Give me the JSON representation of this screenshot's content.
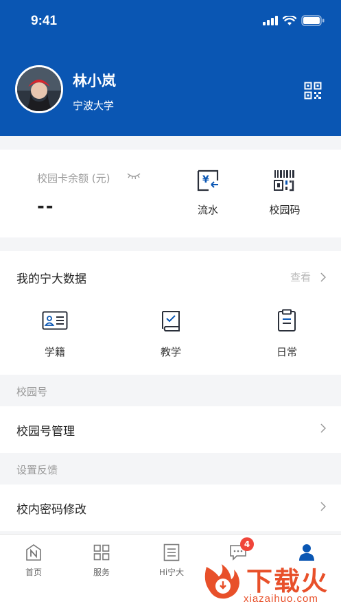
{
  "status_bar": {
    "time": "9:41"
  },
  "profile": {
    "name": "林小岚",
    "school": "宁波大学"
  },
  "campus_card": {
    "balance_label": "校园卡余额 (元)",
    "balance_value": "--",
    "actions": [
      {
        "label": "流水",
        "icon": "transaction-flow-icon"
      },
      {
        "label": "校园码",
        "icon": "campus-barcode-icon"
      }
    ]
  },
  "my_data": {
    "title": "我的宁大数据",
    "view_label": "查看",
    "items": [
      {
        "label": "学籍",
        "icon": "student-id-icon"
      },
      {
        "label": "教学",
        "icon": "teaching-icon"
      },
      {
        "label": "日常",
        "icon": "daily-clipboard-icon"
      }
    ]
  },
  "groups": [
    {
      "label": "校园号",
      "rows": [
        {
          "label": "校园号管理"
        }
      ]
    },
    {
      "label": "设置反馈",
      "rows": [
        {
          "label": "校内密码修改"
        }
      ]
    }
  ],
  "tabbar": {
    "tabs": [
      {
        "label": "首页",
        "icon": "home-n-icon"
      },
      {
        "label": "服务",
        "icon": "grid-icon"
      },
      {
        "label": "Hi宁大",
        "icon": "list-doc-icon"
      },
      {
        "label": "",
        "icon": "message-icon",
        "badge": "4"
      },
      {
        "label": "",
        "icon": "profile-icon",
        "active": true
      }
    ]
  },
  "watermark": {
    "text": "下载火",
    "url": "xiazaihuo.com"
  },
  "colors": {
    "primary": "#0a56b3",
    "badge": "#f0453a",
    "watermark": "#e8502a"
  }
}
